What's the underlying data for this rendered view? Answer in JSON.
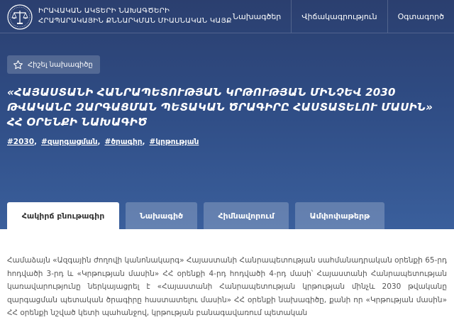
{
  "header": {
    "brand_line1": "ԻՐԱՎԱԿԱՆ ԱԿՏԵՐԻ ՆԱԽԱԳԾԵՐԻ",
    "brand_line2": "ՀՐԱՊԱՐԱԿԱՅԻՆ ՔՆՆԱՐԿՄԱՆ ՄԻԱՍՆԱԿԱՆ ԿԱՅՔ",
    "nav": [
      {
        "label": "Նախագծեր"
      },
      {
        "label": "Վիճակագրություն"
      },
      {
        "label": "Օգտագործ"
      }
    ]
  },
  "bookmark_label": "Հիշել նախագիծը",
  "title": "«ՀԱՅԱՍՏԱՆԻ ՀԱՆՐԱՊԵՏՈՒԹՅԱՆ ԿՐԹՈՒԹՅԱՆ ՄԻՆՉԵՎ 2030 ԹՎԱԿԱՆԸ ԶԱՐԳԱՑՄԱՆ ՊԵՏԱԿԱՆ ԾՐԱԳԻՐԸ ՀԱՍՏԱՏԵԼՈՒ ՄԱՍԻՆ» ՀՀ ՕՐԵՆՔԻ ՆԱԽԱԳԻԾ",
  "tags": [
    "#2030",
    "#զարգացման",
    "#ծրագիր",
    "#կրթության"
  ],
  "tabs": [
    {
      "label": "Հակիրճ բնութագիր",
      "active": true
    },
    {
      "label": "Նախագիծ",
      "active": false
    },
    {
      "label": "Հիմնավորում",
      "active": false
    },
    {
      "label": "Ամփոփաթերթ",
      "active": false
    }
  ],
  "content": "Համաձայն «Ազգային ժողովի կանոնակարգ» Հայաստանի Հանրապետության սահմանադրական օրենքի 65-րդ հոդվածի 3-րդ և «Կրթության մասին» ՀՀ օրենքի 4-րդ հոդվածի 4-րդ մասի՝ Հայաստանի Հանրապետության կառավարությունը ներկայացրել է «Հայաստանի Հանրապետության կրթության մինչև 2030 թվականը զարգացման պետական ծրագիրը հաստատելու մասին» ՀՀ օրենքի նախագիծը, քանի որ «Կրթության մասին» ՀՀ օրենքի նշված կետի պահանջով, կրթության բանագավառում պետական"
}
